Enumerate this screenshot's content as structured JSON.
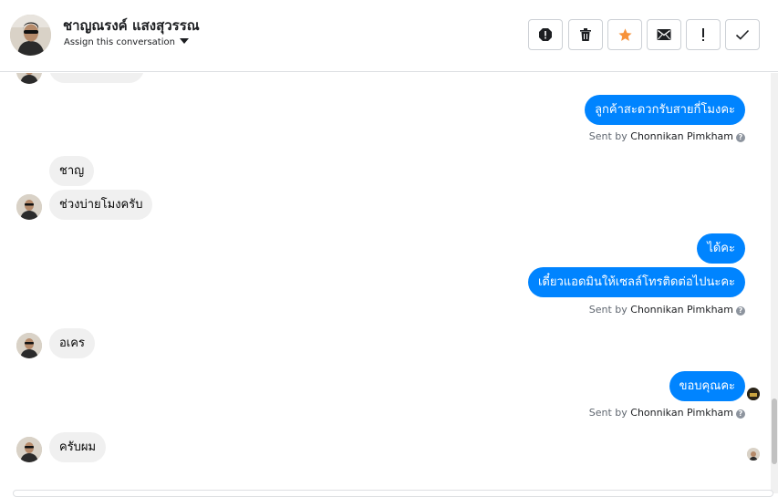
{
  "header": {
    "contact_name": "ชาญณรงค์ แสงสุวรรณ",
    "assign_label": "Assign this conversation"
  },
  "toolbar": {
    "buttons": [
      "report-icon",
      "trash-icon",
      "star-icon",
      "mail-icon",
      "exclamation-icon",
      "check-icon"
    ],
    "star_color": "#f7923a"
  },
  "messages": [
    {
      "side": "out",
      "text": "ลูกค้าสะดวกรับสายกี่โมงคะ"
    },
    {
      "side": "meta",
      "sent_by_prefix": "Sent by",
      "sent_by_name": "Chonnikan Pimkham"
    },
    {
      "side": "in",
      "text": "ชาญ"
    },
    {
      "side": "in",
      "text": "ช่วงบ่ายโมงครับ"
    },
    {
      "side": "out",
      "text": "ได้คะ"
    },
    {
      "side": "out",
      "text": "เดี๋ยวแอดมินให้เซลล์โทรติดต่อไปนะคะ"
    },
    {
      "side": "meta",
      "sent_by_prefix": "Sent by",
      "sent_by_name": "Chonnikan Pimkham"
    },
    {
      "side": "in",
      "text": "อเคร"
    },
    {
      "side": "out",
      "text": "ขอบคุณคะ"
    },
    {
      "side": "meta",
      "sent_by_prefix": "Sent by",
      "sent_by_name": "Chonnikan Pimkham"
    },
    {
      "side": "in",
      "text": "ครับผม"
    }
  ],
  "colors": {
    "outgoing_bubble": "#0084ff",
    "incoming_bubble": "#f0f0f0"
  }
}
